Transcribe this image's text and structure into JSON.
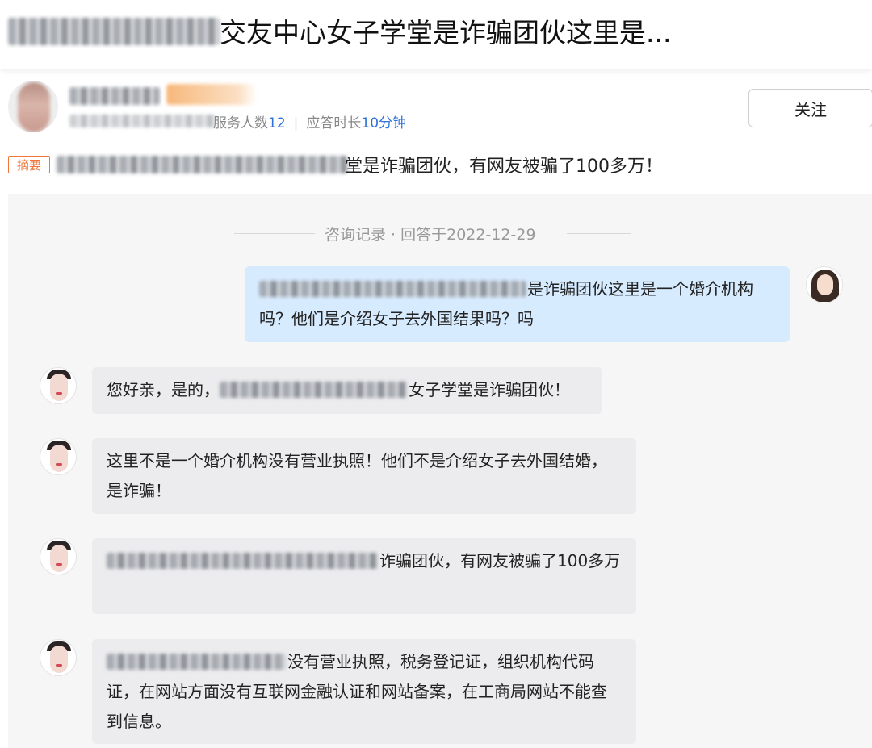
{
  "header": {
    "title_visible": "交友中心女子学堂是诈骗团伙这里是..."
  },
  "expert": {
    "service_count_label": "服务人数",
    "service_count": "12",
    "response_time_label": "应答时长",
    "response_time": "10分钟",
    "follow_label": "关注"
  },
  "summary": {
    "tag": "摘要",
    "text_visible": "堂是诈骗团伙，有网友被骗了100多万！"
  },
  "consultation": {
    "record_label": "咨询记录 · 回答于2022-12-29"
  },
  "messages": {
    "user_q": "是诈骗团伙这里是一个婚介机构吗？他们是介绍女子去外国结果吗？吗",
    "a1_prefix": "您好亲，是的，",
    "a1_suffix": "女子学堂是诈骗团伙！",
    "a2": "这里不是一个婚介机构没有营业执照！他们不是介绍女子去外国结婚，是诈骗！",
    "a3_suffix": "诈骗团伙，有网友被骗了100多万",
    "a4_suffix": "没有营业执照，税务登记证，组织机构代码证，在网站方面没有互联网金融认证和网站备案，在工商局网站不能查到信息。"
  },
  "colors": {
    "accent_blue": "#2f72d8",
    "summary_orange": "#f0763a",
    "user_bubble": "#d7ebff",
    "agent_bubble": "#ececee"
  }
}
